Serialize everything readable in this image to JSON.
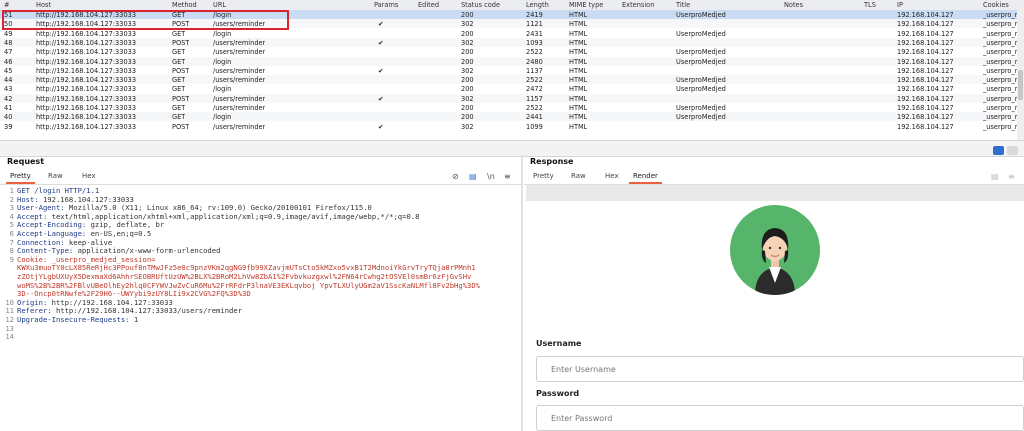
{
  "table": {
    "headers": [
      "#",
      "Host",
      "Method",
      "URL",
      "Params",
      "Edited",
      "Status code",
      "Length",
      "MIME type",
      "Extension",
      "Title",
      "Notes",
      "TLS",
      "IP",
      "Cookies"
    ],
    "rows": [
      {
        "num": "51",
        "host": "http://192.168.104.127:33033",
        "method": "GET",
        "url": "/login",
        "params": "",
        "status": "200",
        "length": "2419",
        "mime": "HTML",
        "title": "UserproMedjed",
        "ip": "192.168.104.127",
        "cookies": "_userpro_me"
      },
      {
        "num": "50",
        "host": "http://192.168.104.127:33033",
        "method": "POST",
        "url": "/users/reminder",
        "params": "✔",
        "status": "302",
        "length": "1121",
        "mime": "HTML",
        "title": "",
        "ip": "192.168.104.127",
        "cookies": "_userpro_me"
      },
      {
        "num": "49",
        "host": "http://192.168.104.127:33033",
        "method": "GET",
        "url": "/login",
        "params": "",
        "status": "200",
        "length": "2431",
        "mime": "HTML",
        "title": "UserproMedjed",
        "ip": "192.168.104.127",
        "cookies": "_userpro_me"
      },
      {
        "num": "48",
        "host": "http://192.168.104.127:33033",
        "method": "POST",
        "url": "/users/reminder",
        "params": "✔",
        "status": "302",
        "length": "1093",
        "mime": "HTML",
        "title": "",
        "ip": "192.168.104.127",
        "cookies": "_userpro_me"
      },
      {
        "num": "47",
        "host": "http://192.168.104.127:33033",
        "method": "GET",
        "url": "/users/reminder",
        "params": "",
        "status": "200",
        "length": "2522",
        "mime": "HTML",
        "title": "UserproMedjed",
        "ip": "192.168.104.127",
        "cookies": "_userpro_me"
      },
      {
        "num": "46",
        "host": "http://192.168.104.127:33033",
        "method": "GET",
        "url": "/login",
        "params": "",
        "status": "200",
        "length": "2480",
        "mime": "HTML",
        "title": "UserproMedjed",
        "ip": "192.168.104.127",
        "cookies": "_userpro_me"
      },
      {
        "num": "45",
        "host": "http://192.168.104.127:33033",
        "method": "POST",
        "url": "/users/reminder",
        "params": "✔",
        "status": "302",
        "length": "1137",
        "mime": "HTML",
        "title": "",
        "ip": "192.168.104.127",
        "cookies": "_userpro_me"
      },
      {
        "num": "44",
        "host": "http://192.168.104.127:33033",
        "method": "GET",
        "url": "/users/reminder",
        "params": "",
        "status": "200",
        "length": "2522",
        "mime": "HTML",
        "title": "UserproMedjed",
        "ip": "192.168.104.127",
        "cookies": "_userpro_me"
      },
      {
        "num": "43",
        "host": "http://192.168.104.127:33033",
        "method": "GET",
        "url": "/login",
        "params": "",
        "status": "200",
        "length": "2472",
        "mime": "HTML",
        "title": "UserproMedjed",
        "ip": "192.168.104.127",
        "cookies": "_userpro_me"
      },
      {
        "num": "42",
        "host": "http://192.168.104.127:33033",
        "method": "POST",
        "url": "/users/reminder",
        "params": "✔",
        "status": "302",
        "length": "1157",
        "mime": "HTML",
        "title": "",
        "ip": "192.168.104.127",
        "cookies": "_userpro_me"
      },
      {
        "num": "41",
        "host": "http://192.168.104.127:33033",
        "method": "GET",
        "url": "/users/reminder",
        "params": "",
        "status": "200",
        "length": "2522",
        "mime": "HTML",
        "title": "UserproMedjed",
        "ip": "192.168.104.127",
        "cookies": "_userpro_me"
      },
      {
        "num": "40",
        "host": "http://192.168.104.127:33033",
        "method": "GET",
        "url": "/login",
        "params": "",
        "status": "200",
        "length": "2441",
        "mime": "HTML",
        "title": "UserproMedjed",
        "ip": "192.168.104.127",
        "cookies": "_userpro_me"
      },
      {
        "num": "39",
        "host": "http://192.168.104.127:33033",
        "method": "POST",
        "url": "/users/reminder",
        "params": "✔",
        "status": "302",
        "length": "1099",
        "mime": "HTML",
        "title": "",
        "ip": "192.168.104.127",
        "cookies": "_userpro_me"
      }
    ]
  },
  "request": {
    "title": "Request",
    "tabs": [
      "Pretty",
      "Raw",
      "Hex"
    ],
    "lines": [
      {
        "n": "1",
        "k": "GET /login HTTP/1.1",
        "v": ""
      },
      {
        "n": "2",
        "k": "Host:",
        "v": " 192.168.104.127:33033"
      },
      {
        "n": "3",
        "k": "User-Agent:",
        "v": " Mozilla/5.0 (X11; Linux x86_64; rv:109.0) Gecko/20100101 Firefox/115.0"
      },
      {
        "n": "4",
        "k": "Accept:",
        "v": " text/html,application/xhtml+xml,application/xml;q=0.9,image/avif,image/webp,*/*;q=0.8"
      },
      {
        "n": "5",
        "k": "Accept-Encoding:",
        "v": " gzip, deflate, br"
      },
      {
        "n": "6",
        "k": "Accept-Language:",
        "v": " en-US,en;q=0.5"
      },
      {
        "n": "7",
        "k": "Connection:",
        "v": " keep-alive"
      },
      {
        "n": "8",
        "k": "Content-Type:",
        "v": " application/x-www-form-urlencoded"
      },
      {
        "n": "9",
        "k": "Cookie:",
        "v": " _userpro_medjed_session="
      },
      {
        "n": "",
        "k": "",
        "v": "KWXu3muoTY0cLX85ReRjHc3PPouf8nTMwJFz5e0c9pnzVKm2qgNG9fb99XZavjmUTsCto5kMZxo5vxB1T2MdnoiYkGrvTryTQja8rPMnh1"
      },
      {
        "n": "",
        "k": "",
        "v": "zZOtjYLgbUXUyX5DexmaXd6AhhrSEOBRUftUzUW%2BLX%2BRoM2LhVw8ZbA1%2Fvbvkuzgxwl%2FN64rCwhg2tOSVEl0smBr6zFjGvSHv"
      },
      {
        "n": "",
        "k": "",
        "v": "woMS%2B%2BR%2FBlvUBeOlhEy2hlq0CFYWVJwZvCuR6Mu%2FrRFdrP3lnaVE3EKLqvboj YpvTLXUlyUGm2aV1SscKaNLMfl8Fv2bHg%3D%"
      },
      {
        "n": "",
        "k": "",
        "v": "3D--Oncp0tRNwfe%2F29H6--UWYybi9zUY8LIi9x2CVG%2FQ%3D%3D"
      },
      {
        "n": "10",
        "k": "Origin:",
        "v": " http://192.168.104.127:33033"
      },
      {
        "n": "11",
        "k": "Referer:",
        "v": " http://192.168.104.127:33033/users/reminder"
      },
      {
        "n": "12",
        "k": "Upgrade-Insecure-Requests:",
        "v": " 1"
      },
      {
        "n": "13",
        "k": "",
        "v": ""
      },
      {
        "n": "14",
        "k": "",
        "v": ""
      }
    ]
  },
  "response": {
    "title": "Response",
    "tabs": [
      "Pretty",
      "Raw",
      "Hex",
      "Render"
    ],
    "form": {
      "username_label": "Username",
      "username_placeholder": "Enter Username",
      "password_label": "Password",
      "password_placeholder": "Enter Password"
    }
  },
  "colors": {
    "accent": "#e8633a",
    "selected_row": "#c9dcf3",
    "highlight_box": "#d9232e",
    "avatar_bg": "#56b46b"
  }
}
